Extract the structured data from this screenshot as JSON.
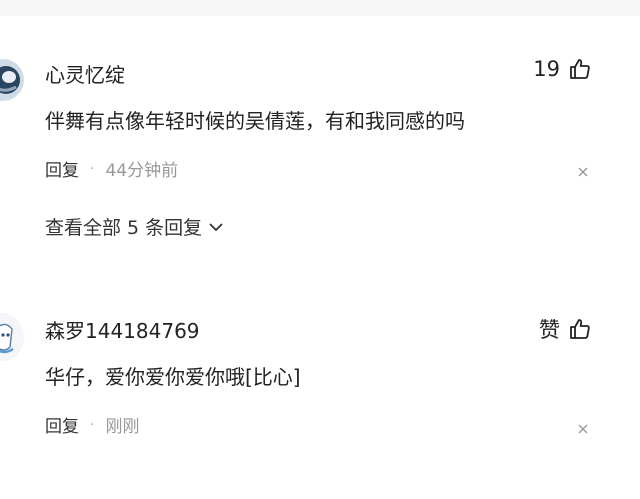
{
  "comments": [
    {
      "username": "心灵忆绽",
      "like_count": "19",
      "content": "伴舞有点像年轻时候的吴倩莲，有和我同感的吗",
      "reply_label": "回复",
      "separator": "·",
      "time": "44分钟前",
      "view_replies": "查看全部 5 条回复"
    },
    {
      "username": "森罗144184769",
      "like_count": "赞",
      "content": "华仔，爱你爱你爱你哦[比心]",
      "reply_label": "回复",
      "separator": "·",
      "time": "刚刚"
    }
  ],
  "icons": {
    "like": "thumbs-up-icon",
    "close": "close-icon",
    "expand": "chevron-down-icon"
  },
  "colors": {
    "text": "#222222",
    "muted": "#999999",
    "background": "#ffffff"
  }
}
